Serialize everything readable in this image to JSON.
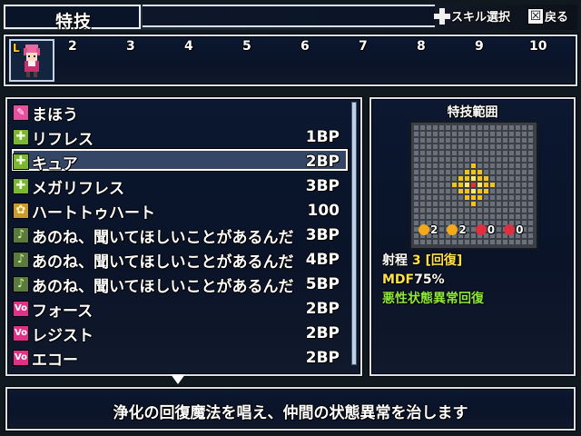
{
  "header": {
    "title": "特技",
    "hint_skill_label": "スキル選択",
    "hint_back_label": "戻る",
    "hint_back_key": "☒"
  },
  "party": {
    "selected_label": "L",
    "slots": [
      "2",
      "3",
      "4",
      "5",
      "6",
      "7",
      "8",
      "9",
      "10"
    ]
  },
  "skills": [
    {
      "icon": "magic-category-icon",
      "name": "まほう",
      "cost": ""
    },
    {
      "icon": "heal-icon",
      "name": "リフレス",
      "cost": "1BP"
    },
    {
      "icon": "heal-icon",
      "name": "キュア",
      "cost": "2BP"
    },
    {
      "icon": "heal-icon",
      "name": "メガリフレス",
      "cost": "3BP"
    },
    {
      "icon": "gold-icon",
      "name": "ハートトゥハート",
      "cost": "100"
    },
    {
      "icon": "note-icon",
      "name": "あのね、聞いてほしいことがあるんだ",
      "cost": "3BP"
    },
    {
      "icon": "note-icon",
      "name": "あのね、聞いてほしいことがあるんだ",
      "cost": "4BP"
    },
    {
      "icon": "note-icon",
      "name": "あのね、聞いてほしいことがあるんだ",
      "cost": "5BP"
    },
    {
      "icon": "voice-icon",
      "name": "フォース",
      "cost": "2BP"
    },
    {
      "icon": "voice-icon",
      "name": "レジスト",
      "cost": "2BP"
    },
    {
      "icon": "voice-icon",
      "name": "エコー",
      "cost": "2BP"
    }
  ],
  "selected_skill_index": 2,
  "icon_labels": {
    "voice": "Vo"
  },
  "range": {
    "title": "特技範囲",
    "stats": [
      "2",
      "2",
      "0",
      "0"
    ],
    "range_label": "射程",
    "range_value": "3",
    "range_type": "[回復]",
    "mdf_label": "MDF",
    "mdf_value": "75%",
    "effect": "悪性状態異常回復"
  },
  "description": "浄化の回復魔法を唱え、仲間の状態異常を治します",
  "colors": {
    "range_center": "#e03040",
    "range_area": "#f5c21a",
    "range_target": "#ffe96a",
    "accent_green": "#8de83c",
    "accent_yellow": "#ffe14a"
  }
}
